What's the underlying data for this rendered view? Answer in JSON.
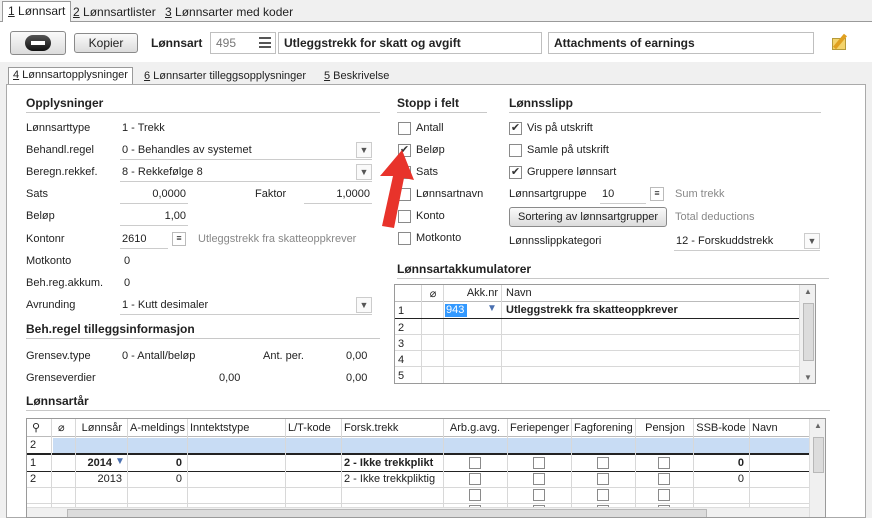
{
  "top_tabs": [
    {
      "key": "1",
      "label": " Lønnsart"
    },
    {
      "key": "2",
      "label": " Lønnsartlister"
    },
    {
      "key": "3",
      "label": " Lønnsarter med koder"
    }
  ],
  "toolbar": {
    "kopier_label": "Kopier",
    "lonnsart_label": "Lønnsart",
    "lonnsart_number": "495",
    "lonnsart_name": "Utleggstrekk for skatt og avgift",
    "lonnsart_name_en": "Attachments of earnings"
  },
  "sub_tabs": [
    {
      "key": "4",
      "label": " Lønnsartopplysninger"
    },
    {
      "key": "6",
      "label": " Lønnsarter tilleggsopplysninger"
    },
    {
      "key": "5",
      "label": " Beskrivelse"
    }
  ],
  "opplysninger": {
    "title": "Opplysninger",
    "lonnsarttype_label": "Lønnsarttype",
    "lonnsarttype_value": "1 - Trekk",
    "behandl_label": "Behandl.regel",
    "behandl_value": "0 - Behandles av systemet",
    "beregn_label": "Beregn.rekkef.",
    "beregn_value": "8 - Rekkefølge 8",
    "sats_label": "Sats",
    "sats_value": "0,0000",
    "faktor_label": "Faktor",
    "faktor_value": "1,0000",
    "belop_label": "Beløp",
    "belop_value": "1,00",
    "kontonr_label": "Kontonr",
    "kontonr_value": "2610",
    "kontonr_desc": "Utleggstrekk fra skatteoppkrever",
    "motkonto_label": "Motkonto",
    "motkonto_value": "0",
    "behreg_label": "Beh.reg.akkum.",
    "behreg_value": "0",
    "avrunding_label": "Avrunding",
    "avrunding_value": "1 - Kutt desimaler"
  },
  "tillegg": {
    "title": "Beh.regel tilleggsinformasjon",
    "grensev_label": "Grensev.type",
    "grensev_value": "0 - Antall/beløp",
    "antper_label": "Ant. per.",
    "antper_value": "0,00",
    "grenseverdier_label": "Grenseverdier",
    "grense_v1": "0,00",
    "grense_v2": "0,00"
  },
  "stopp": {
    "title": "Stopp i felt",
    "items": [
      {
        "label": "Antall",
        "checked": false
      },
      {
        "label": "Beløp",
        "checked": true
      },
      {
        "label": "Sats",
        "checked": false
      },
      {
        "label": "Lønnsartnavn",
        "checked": false
      },
      {
        "label": "Konto",
        "checked": false
      },
      {
        "label": "Motkonto",
        "checked": false
      }
    ]
  },
  "lonnsslipp": {
    "title": "Lønnsslipp",
    "vis_label": "Vis på utskrift",
    "samle_label": "Samle på utskrift",
    "gruppere_label": "Gruppere lønnsart",
    "gruppe_label": "Lønnsartgruppe",
    "gruppe_value": "10",
    "gruppe_desc": "Sum trekk",
    "sortering_label": "Sortering av lønnsartgrupper",
    "sortering_desc": "Total deductions",
    "kategori_label": "Lønnsslippkategori",
    "kategori_value": "12 - Forskuddstrekk"
  },
  "akkumulatorer": {
    "title": "Lønnsartakkumulatorer",
    "col_akk": "Akk.nr",
    "col_navn": "Navn",
    "rows": [
      "1",
      "2",
      "3",
      "4",
      "5"
    ],
    "first_akk": "943",
    "first_navn": "Utleggstrekk fra skatteoppkrever"
  },
  "lonnsarar": {
    "title": "Lønnsartår",
    "headers": [
      "Lønnsår",
      "A-meldings",
      "Inntektstype",
      "L/T-kode",
      "Forsk.trekk",
      "Arb.g.avg.",
      "Feriepenger",
      "Fagforening",
      "Pensjon",
      "SSB-kode",
      "Navn"
    ],
    "rownums": [
      "2",
      "1",
      "2"
    ],
    "row1": {
      "year": "2014",
      "ameld": "0",
      "forsk": "2 - Ikke trekkplikt",
      "ssb": "0"
    },
    "row2": {
      "year": "2013",
      "ameld": "0",
      "forsk": "2 - Ikke trekkpliktig",
      "ssb": "0"
    }
  },
  "colors": {
    "accent_blue": "#c8dcf4",
    "selection": "#3399ff",
    "arrow_red": "#e8332b"
  }
}
